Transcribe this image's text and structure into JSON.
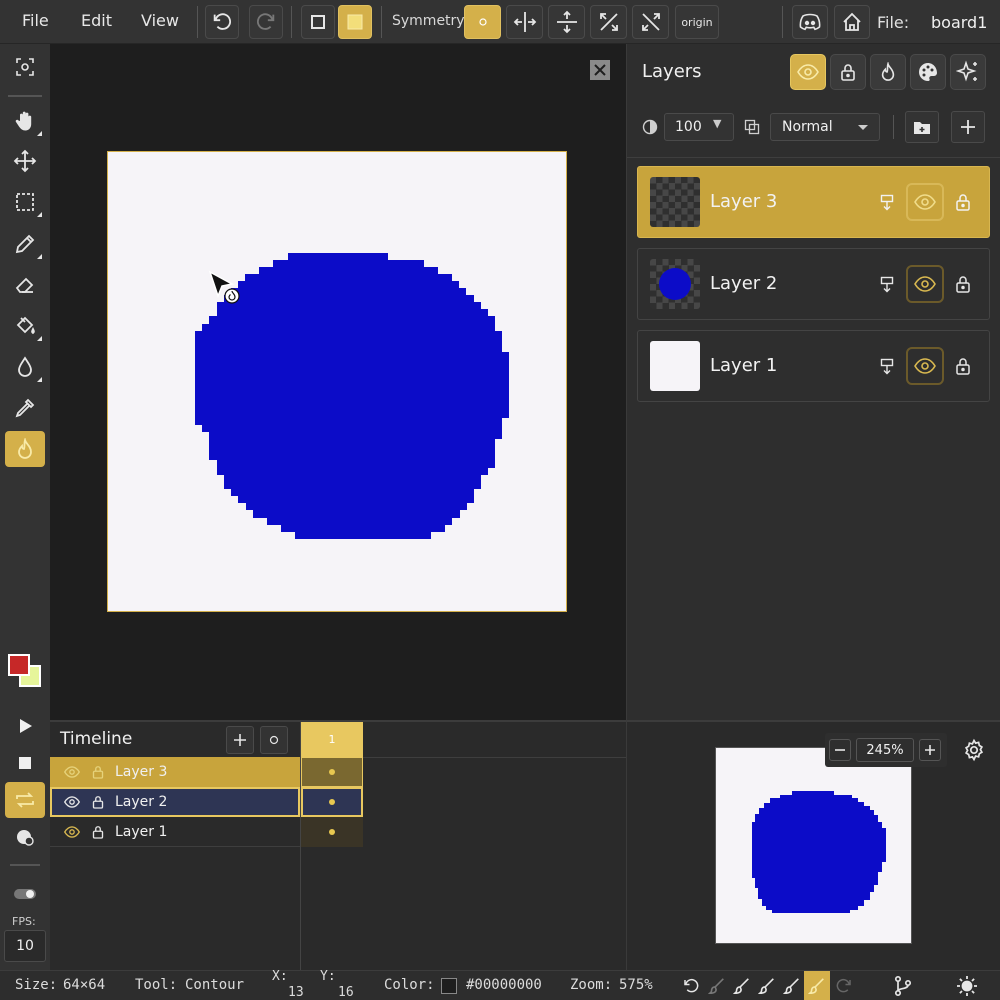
{
  "menu": {
    "file": "File",
    "edit": "Edit",
    "view": "View"
  },
  "toolbar": {
    "symmetry_label": "Symmetry:",
    "origin_label": "origin",
    "file_label": "File:",
    "file_name": "board1"
  },
  "layers_panel": {
    "title": "Layers",
    "opacity_value": "100",
    "blend_mode": "Normal",
    "layers": [
      {
        "name": "Layer 3",
        "selected": true
      },
      {
        "name": "Layer 2",
        "selected": false
      },
      {
        "name": "Layer 1",
        "selected": false
      }
    ]
  },
  "timeline": {
    "title": "Timeline",
    "frame_number": "1",
    "rows": [
      {
        "name": "Layer 3"
      },
      {
        "name": "Layer 2"
      },
      {
        "name": "Layer 1"
      }
    ]
  },
  "left_tools": {
    "fps_label": "FPS:",
    "fps_value": "10"
  },
  "colors": {
    "primary": "#c62828",
    "secondary": "#e6f59a",
    "accent": "#d4b04a",
    "drawn_blue": "#0c0cc8"
  },
  "navigator": {
    "zoom": "245%"
  },
  "status": {
    "size_label": "Size:",
    "size_value": "64×64",
    "tool_label": "Tool:",
    "tool_value": "Contour",
    "x_label": "X:",
    "x_value": "13",
    "y_label": "Y:",
    "y_value": "16",
    "color_label": "Color:",
    "color_value": "#00000000",
    "zoom_label": "Zoom:",
    "zoom_value": "575%"
  },
  "icons": [
    "undo-icon",
    "redo-icon",
    "square-outline-icon",
    "square-fill-icon",
    "symmetry-center-icon",
    "symmetry-horizontal-icon",
    "symmetry-vertical-icon",
    "symmetry-diagonal-icon",
    "symmetry-antidiagonal-icon",
    "discord-icon",
    "home-icon",
    "eye-icon",
    "lock-icon",
    "flame-icon",
    "palette-icon",
    "sparkle-icon",
    "folder-icon",
    "plus-icon",
    "close-icon",
    "gear-icon"
  ]
}
